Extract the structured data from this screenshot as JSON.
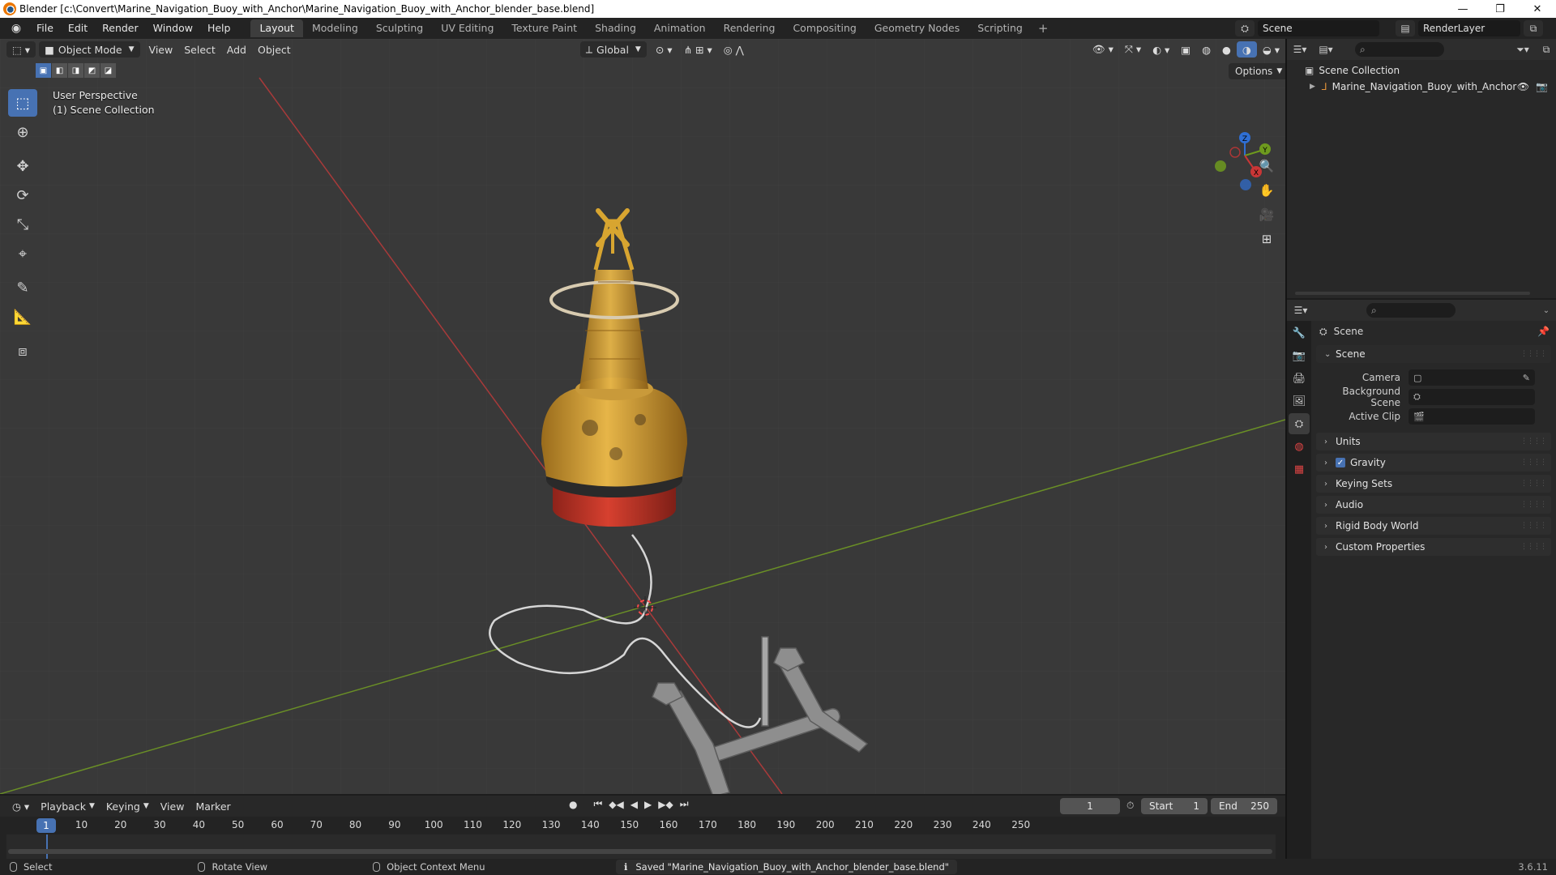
{
  "window": {
    "title": "Blender [c:\\Convert\\Marine_Navigation_Buoy_with_Anchor\\Marine_Navigation_Buoy_with_Anchor_blender_base.blend]",
    "minimize": "—",
    "maximize": "❐",
    "close": "✕"
  },
  "menubar": {
    "menus": [
      "File",
      "Edit",
      "Render",
      "Window",
      "Help"
    ],
    "workspaces": [
      "Layout",
      "Modeling",
      "Sculpting",
      "UV Editing",
      "Texture Paint",
      "Shading",
      "Animation",
      "Rendering",
      "Compositing",
      "Geometry Nodes",
      "Scripting"
    ],
    "active_workspace": "Layout",
    "add_workspace": "+",
    "scene_name": "Scene",
    "view_layer": "RenderLayer"
  },
  "viewport": {
    "mode": "Object Mode",
    "menus": [
      "View",
      "Select",
      "Add",
      "Object"
    ],
    "transform_orientation": "Global",
    "options": "Options",
    "perspective_label": "User Perspective",
    "collection_label": "(1) Scene Collection",
    "gizmo_axes": {
      "x": "X",
      "y": "Y",
      "z": "Z"
    },
    "colors": {
      "x_axis": "#c93636",
      "y_axis": "#6e9a1e",
      "z_axis": "#2f6fd4",
      "selected_tool": "#4772b3",
      "buoy_body": "#d8a530",
      "buoy_band": "#c83a2a"
    }
  },
  "toolbar": {
    "tools": [
      "select-box-icon",
      "cursor-icon",
      "move-icon",
      "rotate-icon",
      "scale-icon",
      "transform-icon",
      "annotate-icon",
      "measure-icon",
      "add-cube-icon"
    ]
  },
  "outliner": {
    "root": "Scene Collection",
    "items": [
      {
        "label": "Marine_Navigation_Buoy_with_Anchor"
      }
    ]
  },
  "properties": {
    "context_title": "Scene",
    "section_title": "Scene",
    "fields": [
      {
        "label": "Camera",
        "value": ""
      },
      {
        "label": "Background Scene",
        "value": ""
      },
      {
        "label": "Active Clip",
        "value": ""
      }
    ],
    "panels": [
      "Units",
      "Gravity",
      "Keying Sets",
      "Audio",
      "Rigid Body World",
      "Custom Properties"
    ],
    "gravity_checked": true
  },
  "timeline": {
    "menus": [
      "Playback",
      "Keying",
      "View",
      "Marker"
    ],
    "current_frame": "1",
    "start_label": "Start",
    "start": "1",
    "end_label": "End",
    "end": "250",
    "ticks": [
      "10",
      "20",
      "30",
      "40",
      "50",
      "60",
      "70",
      "80",
      "90",
      "100",
      "110",
      "120",
      "130",
      "140",
      "150",
      "160",
      "170",
      "180",
      "190",
      "200",
      "210",
      "220",
      "230",
      "240",
      "250"
    ],
    "playhead": "1"
  },
  "statusbar": {
    "hints": [
      "Select",
      "Rotate View",
      "Object Context Menu"
    ],
    "message": "Saved \"Marine_Navigation_Buoy_with_Anchor_blender_base.blend\"",
    "version": "3.6.11"
  }
}
